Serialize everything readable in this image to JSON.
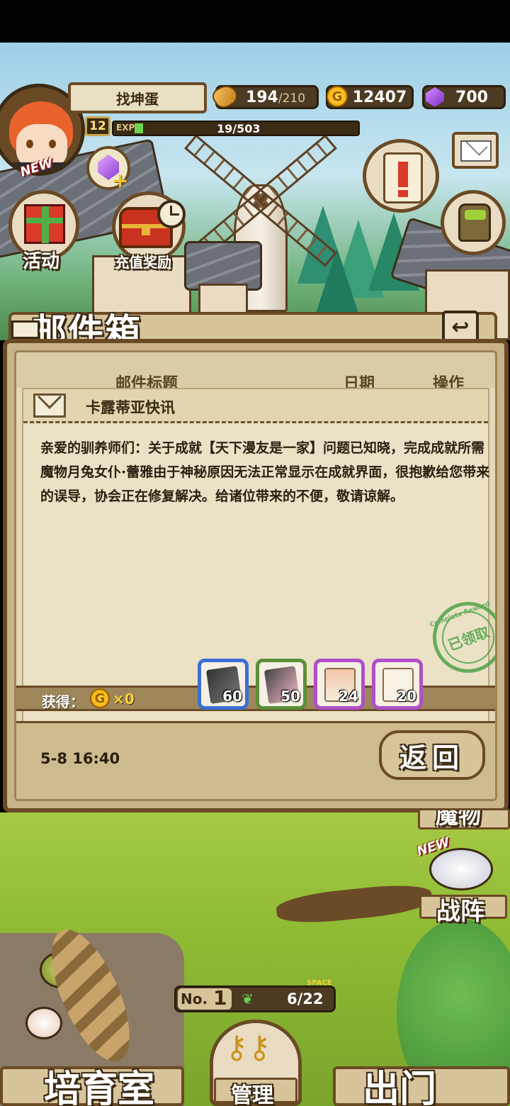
{
  "header": {
    "player_name": "找坤蛋",
    "level": "12",
    "avatar_badge": "NEW",
    "exp_label": "EXP",
    "exp_value": "19/503",
    "stamina_current": "194",
    "stamina_max": "/210",
    "coin_symbol": "G",
    "gold": "12407",
    "gems": "700"
  },
  "left_menu": {
    "activity_label": "活动",
    "recharge_label": "充值奖励"
  },
  "mailbox": {
    "title": "邮件箱",
    "col_subject": "邮件标题",
    "col_date": "日期",
    "col_action": "操作",
    "mail_title": "卡露蒂亚快讯",
    "mail_body": "亲爱的驯养师们：关于成就【天下漫友是一家】问题已知晓，完成成就所需魔物月兔女仆·蕾雅由于神秘原因无法正常显示在成就界面，很抱歉给您带来的误导，协会正在修复解决。给诸位带来的不便，敬请谅解。",
    "stamp_text": "已领取",
    "stamp_ring": "Complete Reward",
    "obtain_label": "获得：",
    "coin_symbol": "G",
    "gold_reward": "×0",
    "items": [
      {
        "count": "60",
        "border": "#3b6fd6"
      },
      {
        "count": "50",
        "border": "#5a8f3a"
      },
      {
        "count": "24",
        "border": "#b04fc8"
      },
      {
        "count": "20",
        "border": "#b04fc8"
      }
    ],
    "date": "5-8 16:40",
    "back_button": "返回"
  },
  "bottom": {
    "monster_label": "魔物",
    "formation_badge": "NEW",
    "formation_label": "战阵",
    "no_label": "No.",
    "no_value": "1",
    "space_label": "SPACE",
    "space_value": "6/22",
    "nursery_label": "培育室",
    "manage_label": "管理",
    "go_out_label": "出门"
  }
}
